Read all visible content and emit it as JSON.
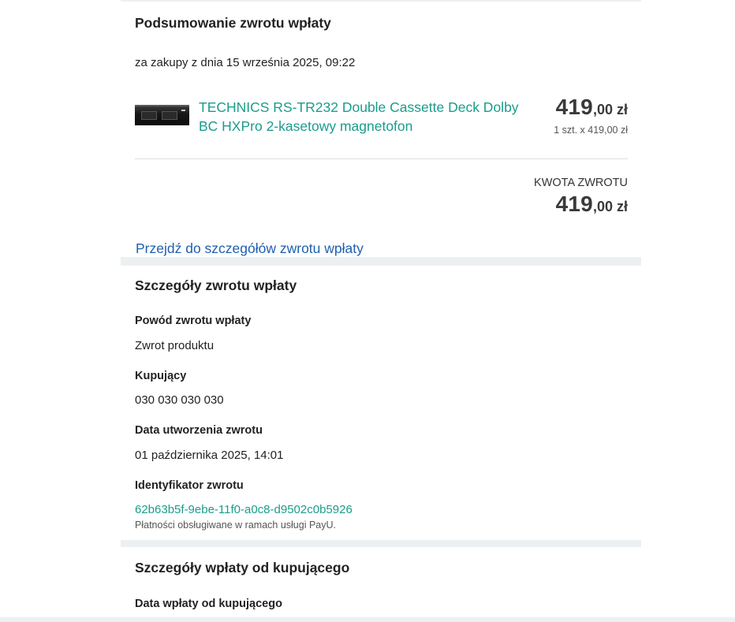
{
  "summary": {
    "title": "Podsumowanie zwrotu wpłaty",
    "purchase_date": "za zakupy z dnia 15 września 2025, 09:22",
    "product": {
      "name": "TECHNICS RS-TR232 Double Cassette Deck Dolby BC HXPro 2-kasetowy magnetofon",
      "price_int": "419",
      "price_dec": ",00 zł",
      "unit_line": "1 szt. x 419,00 zł"
    },
    "refund_label": "KWOTA ZWROTU",
    "refund_int": "419",
    "refund_dec": ",00 zł",
    "details_link": "Przejdź do szczegółów zwrotu wpłaty"
  },
  "details": {
    "title": "Szczegóły zwrotu wpłaty",
    "reason_label": "Powód zwrotu wpłaty",
    "reason_value": "Zwrot produktu",
    "buyer_label": "Kupujący",
    "buyer_value": "030 030 030 030",
    "created_label": "Data utworzenia zwrotu",
    "created_value": "01 października 2025, 14:01",
    "id_label": "Identyfikator zwrotu",
    "id_value": "62b63b5f-9ebe-11f0-a0c8-d9502c0b5926",
    "payu_note": "Płatności obsługiwane w ramach usługi PayU."
  },
  "payment": {
    "title": "Szczegóły wpłaty od kupującego",
    "date_label": "Data wpłaty od kupującego"
  }
}
